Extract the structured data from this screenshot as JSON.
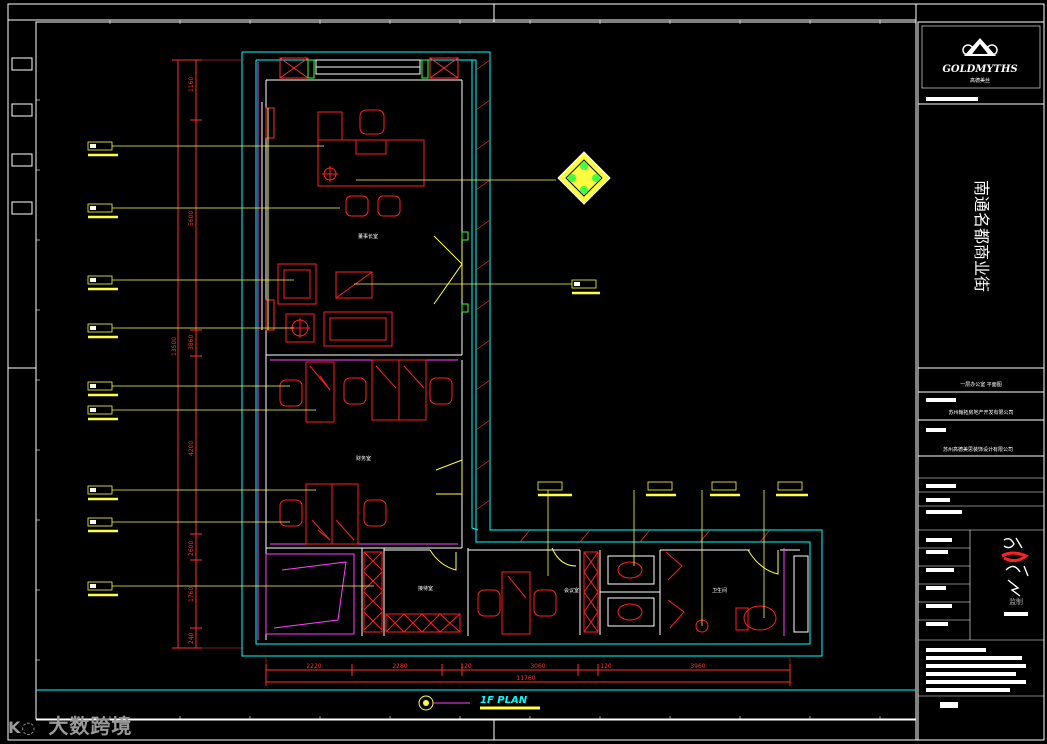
{
  "title_block": {
    "brand": "GOLDMYTHS",
    "brand_sub": "高德美丝",
    "project_name": "南通名都商业街",
    "drawing_title": "一层办公室 平面图",
    "client": "苏州翰拓房地产开发有限公司",
    "designer": "苏州高德美思装饰设计有限公司",
    "seal_text": "监制"
  },
  "plan": {
    "plan_title": "1F PLAN",
    "room_labels": [
      "董事长室",
      "财务室",
      "接待室",
      "会议室",
      "卫生间"
    ],
    "dims_left": [
      "1160",
      "5600",
      "13500",
      "3860",
      "4200",
      "2600",
      "1760",
      "240"
    ],
    "dims_bottom": [
      "2220",
      "2280",
      "120",
      "3060",
      "120",
      "3960"
    ],
    "total_width": "11760"
  },
  "watermark": "大数跨境",
  "colors": {
    "background": "#000000",
    "wall": "#00ffff",
    "furniture": "#ff2020",
    "dimension": "#ff3030",
    "leader": "#ffff40",
    "frame": "#ffffff",
    "partition": "#ff40ff",
    "fixture": "#40ff40"
  }
}
